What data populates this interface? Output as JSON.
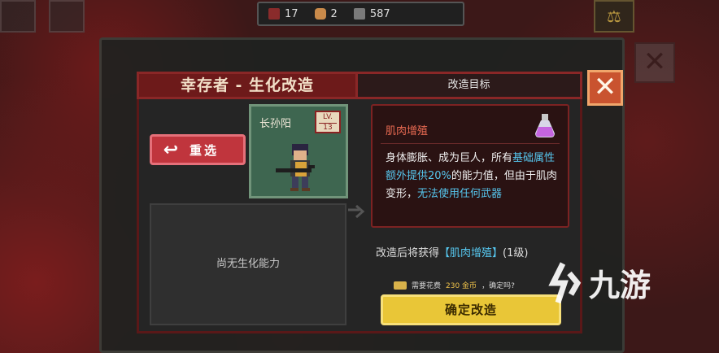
{
  "topbar": {
    "days": "17",
    "food": "2",
    "money": "587"
  },
  "header": {
    "title": "幸存者 - 生化改造",
    "target_label": "改造目标"
  },
  "reselect": {
    "label": "重选"
  },
  "character": {
    "name": "长孙阳",
    "lv_label": "LV.",
    "level": "13"
  },
  "ability_box": {
    "empty_text": "尚无生化能力"
  },
  "info": {
    "title": "肌肉增殖",
    "desc_parts": [
      "身体膨胀、成为巨人，所有",
      "基础属性额外提供20%",
      "的能力值，但由于肌肉变形，",
      "无法使用任何武器"
    ]
  },
  "obtain": {
    "prefix": "改造后将获得",
    "ability": "【肌肉增殖】",
    "level": "(1级)"
  },
  "cost": {
    "prefix": "需要花费",
    "amount": "230 金币",
    "suffix": "，确定吗?"
  },
  "confirm": {
    "label": "确定改造"
  },
  "watermark": {
    "text": "九游"
  },
  "colors": {
    "accent_red": "#c0353d",
    "highlight_blue": "#56c7ef",
    "confirm_yellow": "#e9c637",
    "title_orange": "#e86a52"
  },
  "icons": [
    "calendar-icon",
    "bread-icon",
    "money-icon",
    "scale-icon",
    "close-icon",
    "back-arrow-icon",
    "potion-icon",
    "coin-icon"
  ]
}
